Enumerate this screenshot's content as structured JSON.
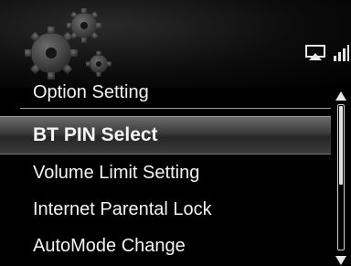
{
  "header": {
    "status_icons": [
      "airplay-icon",
      "signal-bars-icon"
    ],
    "section_title": "Option Setting"
  },
  "menu": {
    "items": [
      {
        "label": "BT PIN Select",
        "selected": true
      },
      {
        "label": "Volume Limit Setting",
        "selected": false
      },
      {
        "label": "Internet Parental Lock",
        "selected": false
      },
      {
        "label": "AutoMode Change",
        "selected": false
      }
    ]
  },
  "scrollbar": {
    "position_fraction": 0.0,
    "visible_fraction": 0.55
  },
  "colors": {
    "background": "#000000",
    "text": "#f4f4f4",
    "highlight": "#4a4a4a"
  }
}
